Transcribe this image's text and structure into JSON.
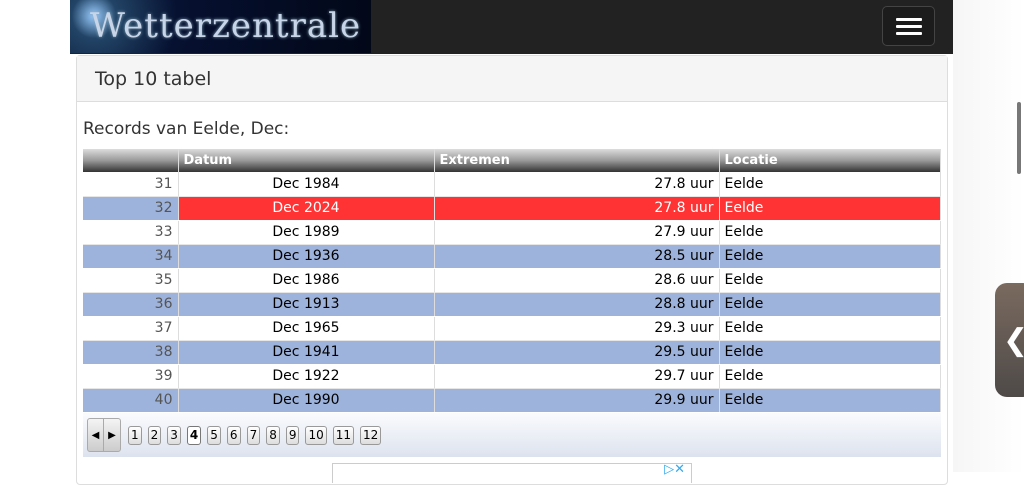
{
  "header": {
    "logo_text": "Wetterzentrale",
    "menu_icon": "hamburger-icon"
  },
  "panel": {
    "title": "Top 10 tabel",
    "subtitle": "Records van Eelde, Dec:"
  },
  "table": {
    "columns": [
      "",
      "Datum",
      "Extremen",
      "Locatie"
    ],
    "rows": [
      {
        "rank": "31",
        "datum": "Dec 1984",
        "extremen": "27.8 uur",
        "locatie": "Eelde"
      },
      {
        "rank": "32",
        "datum": "Dec 2024",
        "extremen": "27.8 uur",
        "locatie": "Eelde"
      },
      {
        "rank": "33",
        "datum": "Dec 1989",
        "extremen": "27.9 uur",
        "locatie": "Eelde"
      },
      {
        "rank": "34",
        "datum": "Dec 1936",
        "extremen": "28.5 uur",
        "locatie": "Eelde"
      },
      {
        "rank": "35",
        "datum": "Dec 1986",
        "extremen": "28.6 uur",
        "locatie": "Eelde"
      },
      {
        "rank": "36",
        "datum": "Dec 1913",
        "extremen": "28.8 uur",
        "locatie": "Eelde"
      },
      {
        "rank": "37",
        "datum": "Dec 1965",
        "extremen": "29.3 uur",
        "locatie": "Eelde"
      },
      {
        "rank": "38",
        "datum": "Dec 1941",
        "extremen": "29.5 uur",
        "locatie": "Eelde"
      },
      {
        "rank": "39",
        "datum": "Dec 1922",
        "extremen": "29.7 uur",
        "locatie": "Eelde"
      },
      {
        "rank": "40",
        "datum": "Dec 1990",
        "extremen": "29.9 uur",
        "locatie": "Eelde"
      }
    ],
    "highlight_color": "#ff3333"
  },
  "pager": {
    "prev": "◀",
    "next": "▶",
    "pages": [
      "1",
      "2",
      "3",
      "4",
      "5",
      "6",
      "7",
      "8",
      "9",
      "10",
      "11",
      "12"
    ],
    "current": "4"
  },
  "sidetab": {
    "label": "❮"
  }
}
